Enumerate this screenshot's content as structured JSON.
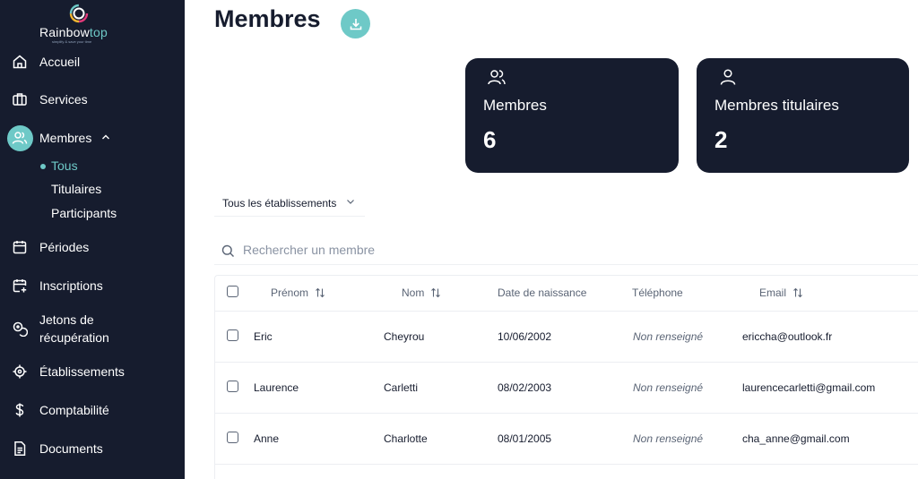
{
  "brand": {
    "name_part1": "Rainbow",
    "name_part2": "top",
    "tagline": "simplify & save your time"
  },
  "sidebar": {
    "items": [
      {
        "label": "Accueil",
        "icon": "home-icon"
      },
      {
        "label": "Services",
        "icon": "briefcase-icon"
      },
      {
        "label": "Membres",
        "icon": "users-icon"
      },
      {
        "label": "Périodes",
        "icon": "calendar-icon"
      },
      {
        "label": "Inscriptions",
        "icon": "calendar-plus-icon"
      },
      {
        "label_line1": "Jetons de",
        "label_line2": "récupération",
        "icon": "tokens-icon"
      },
      {
        "label": "Établissements",
        "icon": "crosshair-icon"
      },
      {
        "label": "Comptabilité",
        "icon": "dollar-icon"
      },
      {
        "label": "Documents",
        "icon": "document-icon"
      }
    ],
    "membres_sub": [
      "Tous",
      "Titulaires",
      "Participants"
    ]
  },
  "header": {
    "title": "Membres"
  },
  "stats": [
    {
      "label": "Membres",
      "value": "6",
      "icon": "users-icon"
    },
    {
      "label": "Membres titulaires",
      "value": "2",
      "icon": "user-icon"
    }
  ],
  "filter": {
    "selected": "Tous les établissements"
  },
  "search": {
    "placeholder": "Rechercher un membre"
  },
  "table": {
    "columns": [
      "Prénom",
      "Nom",
      "Date de naissance",
      "Téléphone",
      "Email"
    ],
    "rows": [
      {
        "prenom": "Eric",
        "nom": "Cheyrou",
        "date": "10/06/2002",
        "tel": "Non renseigné",
        "email": "ericcha@outlook.fr"
      },
      {
        "prenom": "Laurence",
        "nom": "Carletti",
        "date": "08/02/2003",
        "tel": "Non renseigné",
        "email": "laurencecarletti@gmail.com"
      },
      {
        "prenom": "Anne",
        "nom": "Charlotte",
        "date": "08/01/2005",
        "tel": "Non renseigné",
        "email": "cha_anne@gmail.com"
      }
    ]
  },
  "colors": {
    "sidebar_bg": "#161c2e",
    "accent": "#6ec9c7"
  }
}
